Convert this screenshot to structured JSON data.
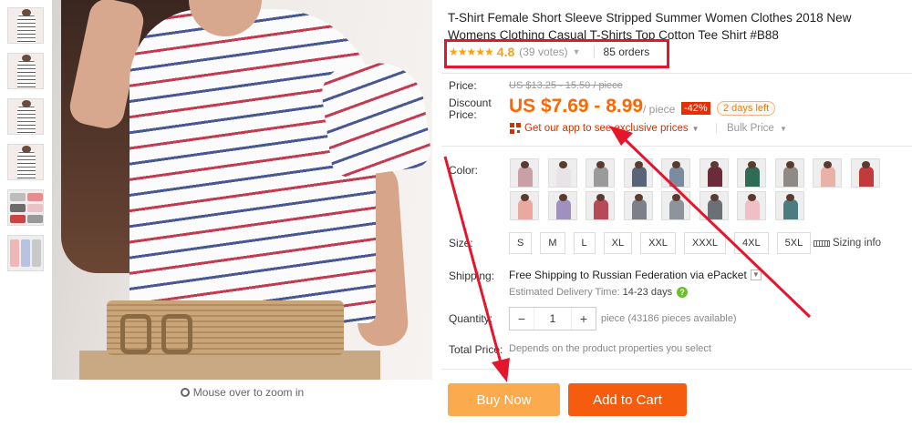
{
  "thumbnails": [
    {
      "name": "thumb-1"
    },
    {
      "name": "thumb-2"
    },
    {
      "name": "thumb-3"
    },
    {
      "name": "thumb-4"
    },
    {
      "name": "thumb-5"
    },
    {
      "name": "thumb-6"
    }
  ],
  "zoom_hint": "Mouse over to zoom in",
  "product": {
    "title": "T-Shirt Female Short Sleeve Stripped Summer Women Clothes 2018 New Womens Clothing Casual T-Shirts Top Cotton Tee Shirt #B88",
    "stars": "★★★★★",
    "rating": "4.8",
    "votes": "(39 votes)",
    "orders": "85 orders"
  },
  "pricing": {
    "price_label": "Price:",
    "old_price": "US $13.25 - 15.50 / piece",
    "discount_label_1": "Discount",
    "discount_label_2": "Price:",
    "discount_price": "US $7.69 - 8.99",
    "per_piece": "/ piece",
    "discount_badge": "-42%",
    "days_left": "2 days left",
    "app_link": "Get our app to see exclusive prices",
    "bulk_price": "Bulk Price"
  },
  "color": {
    "label": "Color:",
    "swatch_colors": [
      "#c9a0a6",
      "#e7e3e6",
      "#9a9a9a",
      "#5a6478",
      "#7d8ba0",
      "#6b2b3b",
      "#2f6b55",
      "#8e8a86",
      "#e9b2a8",
      "#c23a3a",
      "#e9a9a0",
      "#9f90c0",
      "#b84a57",
      "#7d8088",
      "#8e949c",
      "#6b7076",
      "#f0bfc6",
      "#4c7c80"
    ]
  },
  "size": {
    "label": "Size:",
    "options": [
      "S",
      "M",
      "L",
      "XL",
      "XXL",
      "XXXL",
      "4XL",
      "5XL"
    ],
    "sizing_info": "Sizing info"
  },
  "shipping": {
    "label": "Shipping:",
    "text": "Free Shipping to Russian Federation via ePacket",
    "delivery_label": "Estimated Delivery Time:",
    "delivery_days": "14-23 days"
  },
  "quantity": {
    "label": "Quantity:",
    "value": "1",
    "available": "piece (43186 pieces available)"
  },
  "total": {
    "label": "Total Price:",
    "text": "Depends on the product properties you select"
  },
  "actions": {
    "buy_now": "Buy Now",
    "add_to_cart": "Add to Cart"
  },
  "colors": {
    "annotation_red": "#e5162b",
    "price_orange": "#f60",
    "buy_now_bg": "#fcaa4e",
    "add_to_cart_bg": "#f55c0d"
  }
}
